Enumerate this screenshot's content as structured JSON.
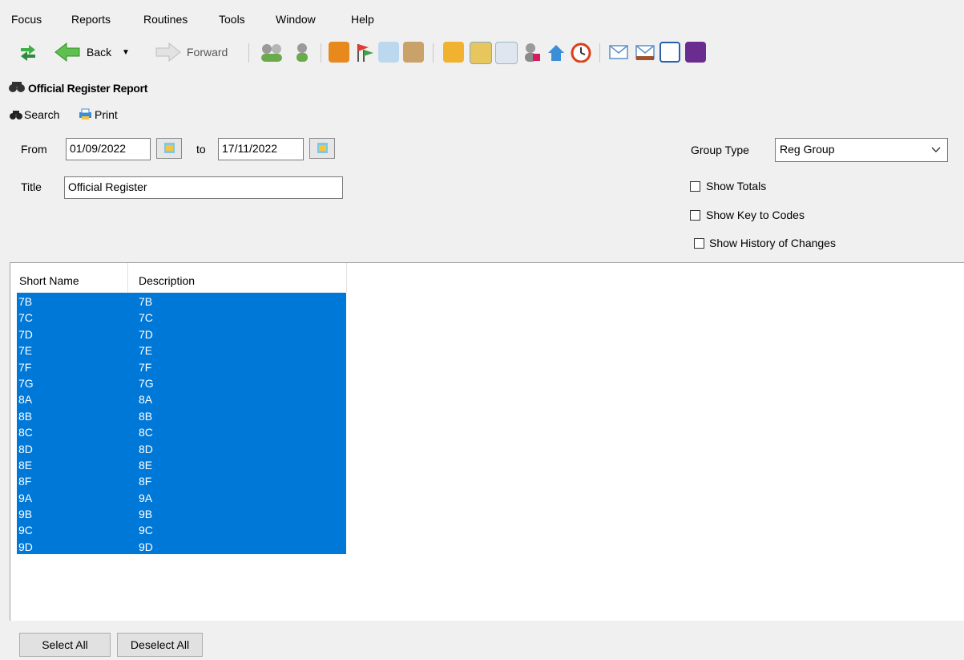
{
  "menu": [
    "Focus",
    "Reports",
    "Routines",
    "Tools",
    "Window",
    "Help"
  ],
  "toolbar": {
    "back_label": "Back",
    "forward_label": "Forward"
  },
  "panel": {
    "title": "Official Register Report",
    "search_label": "Search",
    "print_label": "Print"
  },
  "form": {
    "from_label": "From",
    "from_value": "01/09/2022",
    "to_label": "to",
    "to_value": "17/11/2022",
    "title_label": "Title",
    "title_value": "Official Register",
    "group_type_label": "Group Type",
    "group_type_value": "Reg Group",
    "show_totals": "Show Totals",
    "show_key": "Show Key to Codes",
    "show_history": "Show History of Changes"
  },
  "grid": {
    "columns": [
      "Short Name",
      "Description"
    ],
    "rows": [
      [
        "7B",
        "7B"
      ],
      [
        "7C",
        "7C"
      ],
      [
        "7D",
        "7D"
      ],
      [
        "7E",
        "7E"
      ],
      [
        "7F",
        "7F"
      ],
      [
        "7G",
        "7G"
      ],
      [
        "8A",
        "8A"
      ],
      [
        "8B",
        "8B"
      ],
      [
        "8C",
        "8C"
      ],
      [
        "8D",
        "8D"
      ],
      [
        "8E",
        "8E"
      ],
      [
        "8F",
        "8F"
      ],
      [
        "9A",
        "9A"
      ],
      [
        "9B",
        "9B"
      ],
      [
        "9C",
        "9C"
      ],
      [
        "9D",
        "9D"
      ]
    ]
  },
  "buttons": {
    "select_all": "Select All",
    "deselect_all": "Deselect All"
  },
  "colors": {
    "selection": "#0078d7"
  }
}
